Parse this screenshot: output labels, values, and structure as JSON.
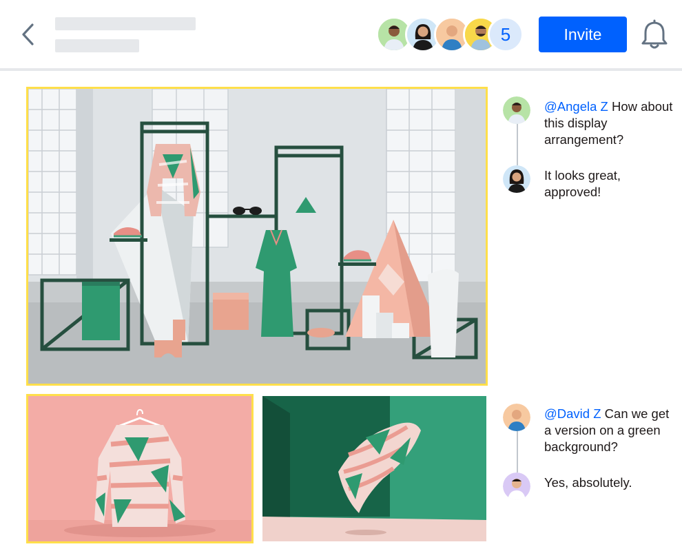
{
  "header": {
    "back_icon": "chevron-left-icon",
    "title_placeholder": "",
    "subtitle_placeholder": "",
    "collaborators_extra_count": "5",
    "invite_label": "Invite",
    "notifications_icon": "bell-icon"
  },
  "collaborators": [
    {
      "name": "collaborator-1",
      "bg": "#b7e3a6"
    },
    {
      "name": "collaborator-2",
      "bg": "#cfe6f7"
    },
    {
      "name": "collaborator-3",
      "bg": "#f7c9a0"
    },
    {
      "name": "collaborator-4",
      "bg": "#f8d84a"
    }
  ],
  "images": [
    {
      "name": "showroom-display-image",
      "selected": true
    },
    {
      "name": "sweater-pink-background-image",
      "selected": true
    },
    {
      "name": "sweater-green-background-image",
      "selected": false
    }
  ],
  "threads": [
    {
      "comments": [
        {
          "mention": "@Angela Z",
          "text": " How about this display arrangement?"
        },
        {
          "mention": "",
          "text": "It looks great, approved!"
        }
      ]
    },
    {
      "comments": [
        {
          "mention": "@David Z",
          "text": " Can we get a version on a green background?"
        },
        {
          "mention": "",
          "text": "Yes, absolutely."
        }
      ]
    }
  ],
  "colors": {
    "accent": "#0061fe",
    "selection": "#ffdf4a",
    "divider": "#e6e8eb"
  }
}
